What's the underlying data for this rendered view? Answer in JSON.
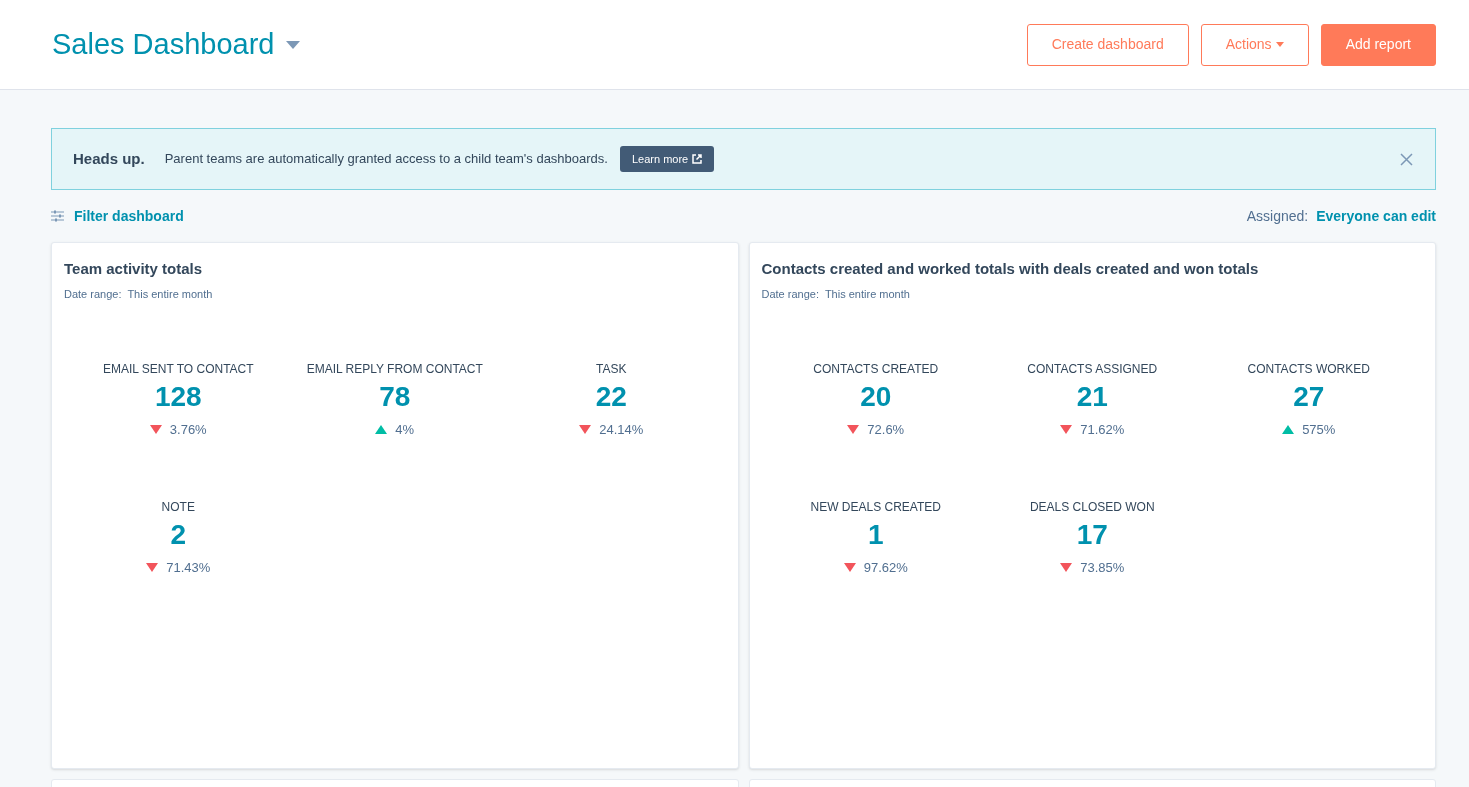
{
  "header": {
    "title": "Sales Dashboard",
    "buttons": [
      {
        "label": "Create dashboard",
        "kind": "outline",
        "caret": false
      },
      {
        "label": "Actions",
        "kind": "outline",
        "caret": true
      },
      {
        "label": "Add report",
        "kind": "primary",
        "caret": false
      }
    ]
  },
  "banner": {
    "title": "Heads up.",
    "message": "Parent teams are automatically granted access to a child team's dashboards.",
    "link": "Learn more"
  },
  "filter": {
    "label": "Filter dashboard"
  },
  "assigned": {
    "label": "Assigned:",
    "value": "Everyone can edit"
  },
  "cards": [
    {
      "title": "Team activity totals",
      "date_range": "Date range:  This entire month",
      "metrics": [
        {
          "label": "EMAIL SENT TO CONTACT",
          "value": "128",
          "kind": "down",
          "change": "3.76%"
        },
        {
          "label": "EMAIL REPLY FROM CONTACT",
          "value": "78",
          "kind": "up",
          "change": "4%"
        },
        {
          "label": "TASK",
          "value": "22",
          "kind": "down",
          "change": "24.14%"
        },
        {
          "label": "NOTE",
          "value": "2",
          "kind": "down",
          "change": "71.43%"
        }
      ]
    },
    {
      "title": "Contacts created and worked totals with deals created and won totals",
      "date_range": "Date range:  This entire month",
      "metrics": [
        {
          "label": "CONTACTS CREATED",
          "value": "20",
          "kind": "down",
          "change": "72.6%"
        },
        {
          "label": "CONTACTS ASSIGNED",
          "value": "21",
          "kind": "down",
          "change": "71.62%"
        },
        {
          "label": "CONTACTS WORKED",
          "value": "27",
          "kind": "up",
          "change": "575%"
        },
        {
          "label": "NEW DEALS CREATED",
          "value": "1",
          "kind": "down",
          "change": "97.62%"
        },
        {
          "label": "DEALS CLOSED WON",
          "value": "17",
          "kind": "down",
          "change": "73.85%"
        }
      ]
    }
  ]
}
